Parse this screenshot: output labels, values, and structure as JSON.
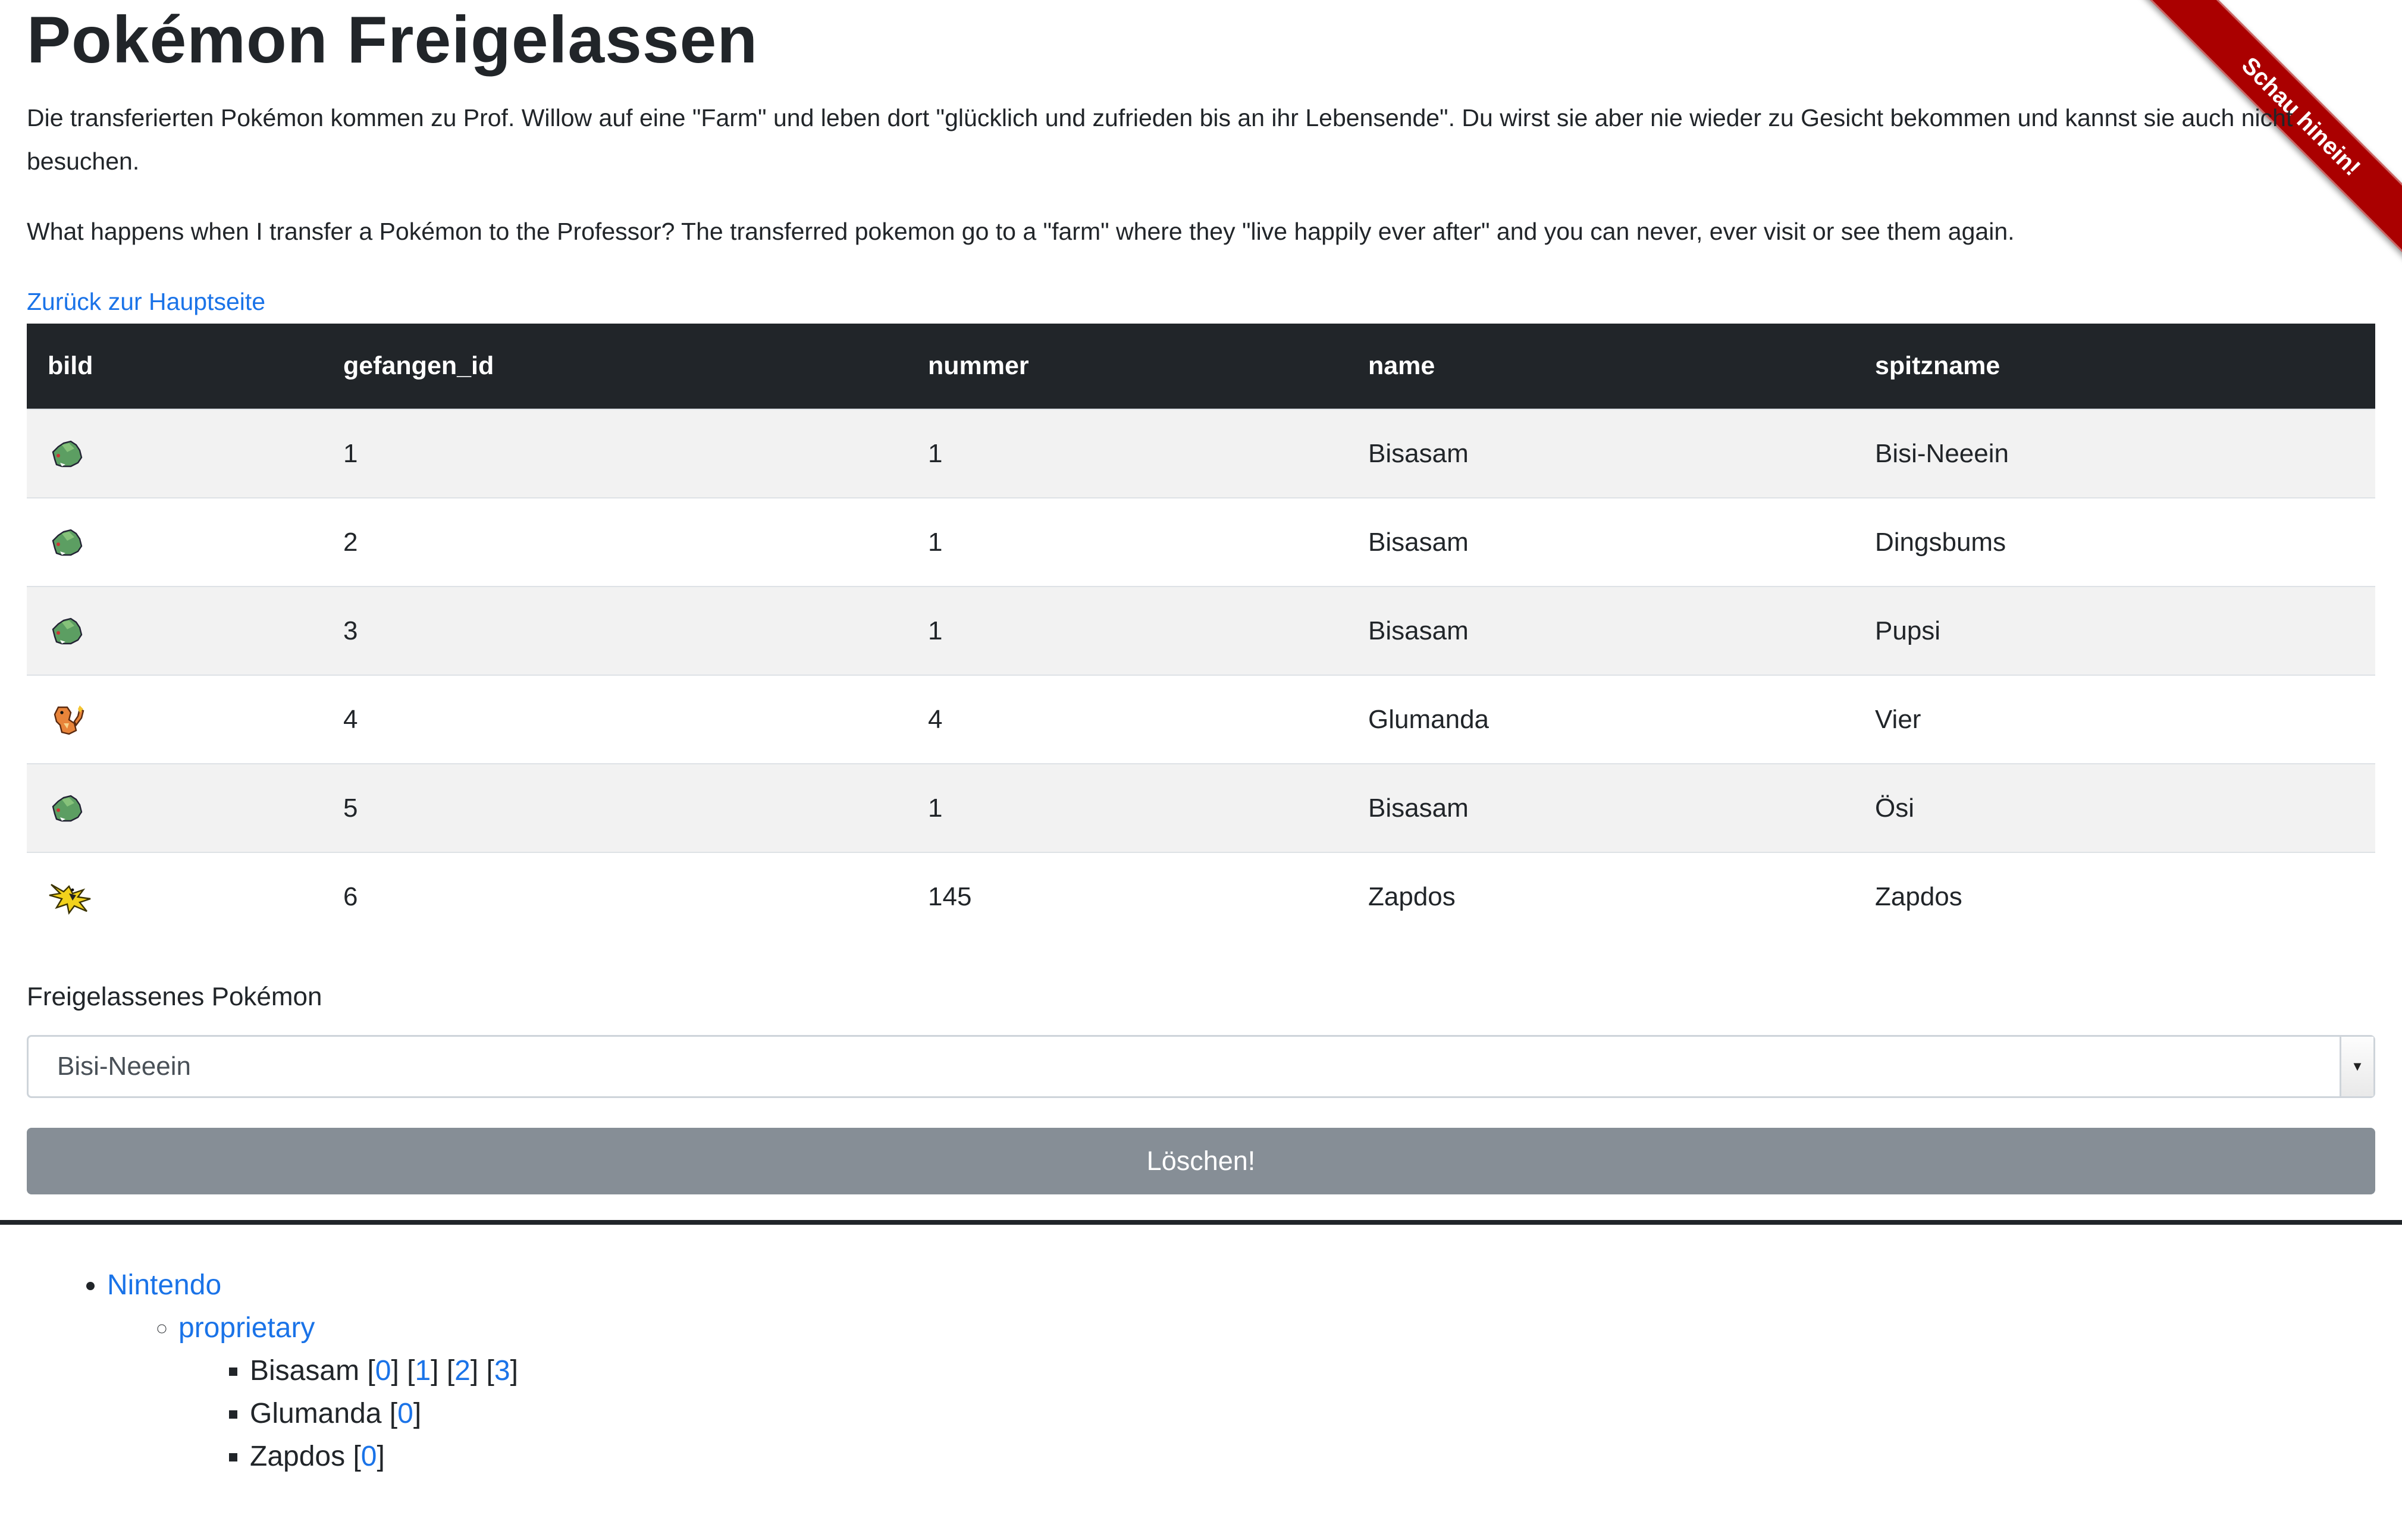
{
  "page": {
    "title": "Pokémon Freigelassen",
    "intro_de": "Die transferierten Pokémon kommen zu Prof. Willow auf eine \"Farm\" und leben dort \"glücklich und zufrieden bis an ihr Lebensende\". Du wirst sie aber nie wieder zu Gesicht bekommen und kannst sie auch nicht besuchen.",
    "intro_en": "What happens when I transfer a Pokémon to the Professor? The transferred pokemon go to a \"farm\" where they \"live happily ever after\" and you can never, ever visit or see them again.",
    "back_link": "Zurück zur Hauptseite"
  },
  "ribbon": {
    "label": "Schau hinein!",
    "color": "#aa0000"
  },
  "table": {
    "headers": [
      "bild",
      "gefangen_id",
      "nummer",
      "name",
      "spitzname"
    ],
    "rows": [
      {
        "icon": "bulbasaur-sprite-icon",
        "gefangen_id": "1",
        "nummer": "1",
        "name": "Bisasam",
        "spitzname": "Bisi-Neeein"
      },
      {
        "icon": "bulbasaur-sprite-icon",
        "gefangen_id": "2",
        "nummer": "1",
        "name": "Bisasam",
        "spitzname": "Dingsbums"
      },
      {
        "icon": "bulbasaur-sprite-icon",
        "gefangen_id": "3",
        "nummer": "1",
        "name": "Bisasam",
        "spitzname": "Pupsi"
      },
      {
        "icon": "charmander-sprite-icon",
        "gefangen_id": "4",
        "nummer": "4",
        "name": "Glumanda",
        "spitzname": "Vier"
      },
      {
        "icon": "bulbasaur-sprite-icon",
        "gefangen_id": "5",
        "nummer": "1",
        "name": "Bisasam",
        "spitzname": "Ösi"
      },
      {
        "icon": "zapdos-sprite-icon",
        "gefangen_id": "6",
        "nummer": "145",
        "name": "Zapdos",
        "spitzname": "Zapdos"
      }
    ]
  },
  "form": {
    "label": "Freigelassenes Pokémon",
    "selected": "Bisi-Neeein",
    "button": "Löschen!"
  },
  "tree": {
    "root": "Nintendo",
    "child": "proprietary",
    "items": [
      {
        "name": "Bisasam",
        "links": [
          "0",
          "1",
          "2",
          "3"
        ]
      },
      {
        "name": "Glumanda",
        "links": [
          "0"
        ]
      },
      {
        "name": "Zapdos",
        "links": [
          "0"
        ]
      }
    ]
  }
}
